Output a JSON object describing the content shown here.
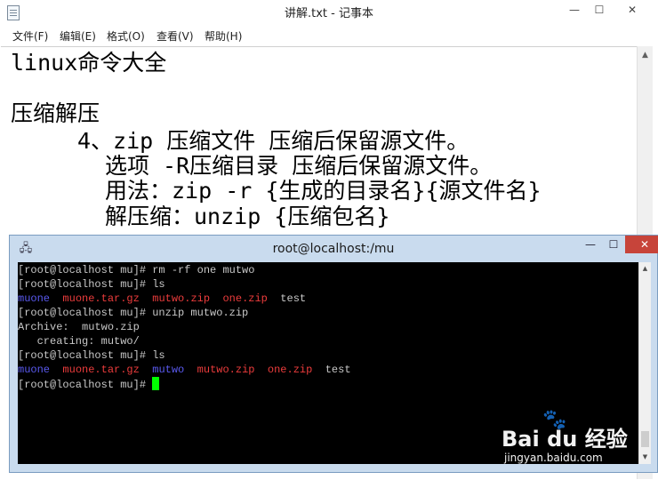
{
  "notepad": {
    "title": "讲解.txt - 记事本",
    "controls": {
      "minimize": "—",
      "maximize": "☐",
      "close": "✕"
    },
    "menu": [
      "文件(F)",
      "编辑(E)",
      "格式(O)",
      "查看(V)",
      "帮助(H)"
    ],
    "lines": [
      "linux命令大全",
      "压缩解压",
      "4、zip 压缩文件 压缩后保留源文件。",
      "选项 -R压缩目录 压缩后保留源文件。",
      "用法：zip -r {生成的目录名}{源文件名}",
      "解压缩：unzip {压缩包名}"
    ],
    "scroll_up": "▲"
  },
  "terminal": {
    "title": "root@localhost:/mu",
    "icon": "🖧",
    "controls": {
      "minimize": "—",
      "maximize": "☐",
      "close": "✕"
    },
    "lines": {
      "l1": "[root@localhost mu]# rm -rf one mutwo",
      "l2": "[root@localhost mu]# ls",
      "l3": {
        "a": "muone",
        "b": "muone.tar.gz",
        "c": "mutwo.zip",
        "d": "one.zip",
        "e": "test"
      },
      "l4": "[root@localhost mu]# unzip mutwo.zip",
      "l5": "Archive:  mutwo.zip",
      "l6": "   creating: mutwo/",
      "l7": "[root@localhost mu]# ls",
      "l8": {
        "a": "muone",
        "b": "muone.tar.gz",
        "c": "mutwo",
        "d": "mutwo.zip",
        "e": "one.zip",
        "f": "test"
      },
      "l9": "[root@localhost mu]# "
    },
    "scroll_up": "▲",
    "scroll_down": "▼",
    "colors": {
      "directory": "#5a5af0",
      "archive": "#ec3c3c",
      "cursor": "#00ff00"
    }
  },
  "watermark": {
    "brand": "Bai du 经验",
    "url": "jingyan.baidu.com"
  }
}
